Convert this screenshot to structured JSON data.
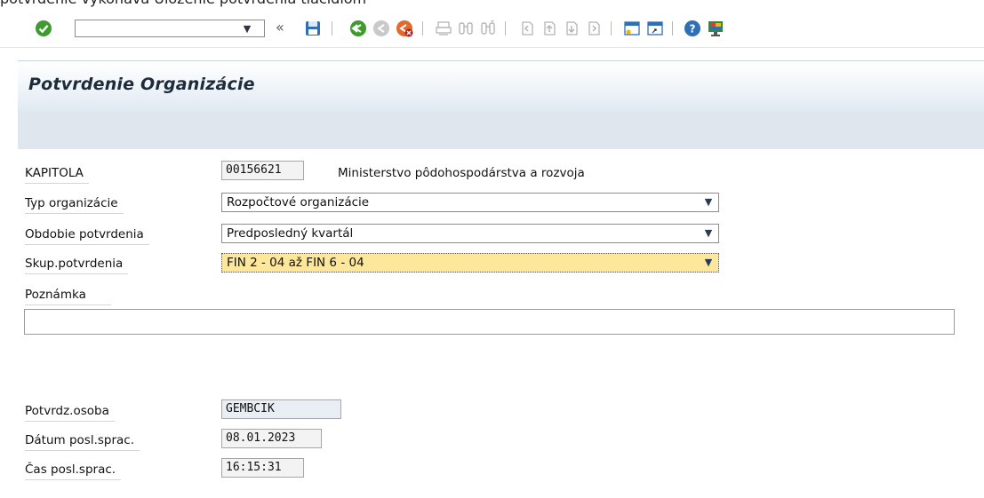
{
  "caption": "potvrdenie vykonáva  Uloženie potvrdenia tlačidlom",
  "toolbar": {
    "command_value": "",
    "buttons": [
      {
        "name": "enter-icon"
      },
      {
        "name": "save-icon"
      },
      {
        "name": "back-icon"
      },
      {
        "name": "exit-icon"
      },
      {
        "name": "cancel-icon"
      },
      {
        "name": "print-icon"
      },
      {
        "name": "find-icon"
      },
      {
        "name": "find-next-icon"
      },
      {
        "name": "first-page-icon"
      },
      {
        "name": "previous-page-icon"
      },
      {
        "name": "next-page-icon"
      },
      {
        "name": "last-page-icon"
      },
      {
        "name": "new-session-icon"
      },
      {
        "name": "shortcut-icon"
      },
      {
        "name": "help-icon"
      },
      {
        "name": "customize-layout-icon"
      }
    ]
  },
  "screen": {
    "title": "Potvrdenie Organizácie"
  },
  "form": {
    "kapitola": {
      "label": "KAPITOLA",
      "code": "00156621",
      "name": "Ministerstvo pôdohospodárstva a rozvoja"
    },
    "typ": {
      "label": "Typ organizácie",
      "value": "Rozpočtové organizácie"
    },
    "obdobie": {
      "label": "Obdobie potvrdenia",
      "value": "Predposledný kvartál"
    },
    "skupina": {
      "label": "Skup.potvrdenia",
      "value": "FIN 2 - 04 až FIN 6 - 04"
    },
    "poznamka": {
      "label": "Poznámka",
      "value": ""
    },
    "osoba": {
      "label": "Potvrdz.osoba",
      "value": "GEMBCIK"
    },
    "datum": {
      "label": "Dátum posl.sprac.",
      "value": "08.01.2023"
    },
    "cas": {
      "label": "Čas posl.sprac.",
      "value": "16:15:31"
    }
  },
  "colors": {
    "focus_field": "#fde79a",
    "title_bar": "#dfe8f1",
    "sub_bar": "#dfe6ee"
  }
}
